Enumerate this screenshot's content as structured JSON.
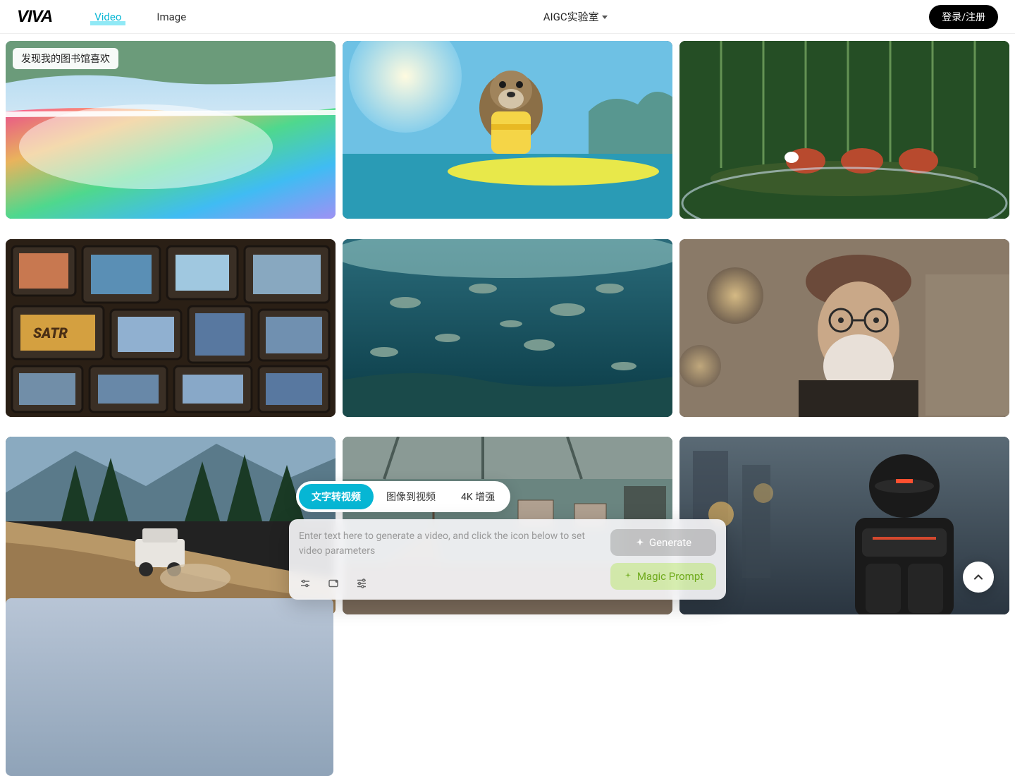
{
  "header": {
    "logo": "VIVA",
    "nav": {
      "video": "Video",
      "image": "Image"
    },
    "center": "AIGC实验室",
    "login": "登录/注册"
  },
  "gallery": {
    "badge_label": "发现我的图书馆喜欢",
    "cards": [
      {
        "name": "rainbow-waterfall"
      },
      {
        "name": "otter-surfboard"
      },
      {
        "name": "red-pandas-terrarium"
      },
      {
        "name": "tv-wall"
      },
      {
        "name": "underwater-fish"
      },
      {
        "name": "old-man-portrait"
      },
      {
        "name": "offroad-truck"
      },
      {
        "name": "warehouse-ship"
      },
      {
        "name": "robot-city"
      }
    ]
  },
  "panel": {
    "tabs": {
      "text2video": "文字转视频",
      "image2video": "图像到视频",
      "upscale": "4K 增强"
    },
    "placeholder": "Enter text here to generate a video, and click the icon below to set video parameters",
    "generate": "Generate",
    "magic": "Magic Prompt"
  }
}
